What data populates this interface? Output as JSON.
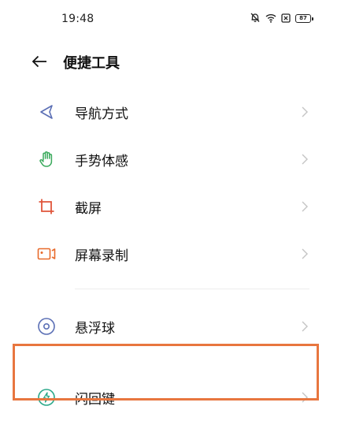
{
  "status_bar": {
    "time": "19:48",
    "battery": "87"
  },
  "header": {
    "title": "便捷工具"
  },
  "menu": {
    "items": [
      {
        "label": "导航方式",
        "icon": "navigation-triangle-icon"
      },
      {
        "label": "手势体感",
        "icon": "hand-gesture-icon"
      },
      {
        "label": "截屏",
        "icon": "crop-screenshot-icon"
      },
      {
        "label": "屏幕录制",
        "icon": "screen-record-icon"
      }
    ],
    "items2": [
      {
        "label": "悬浮球",
        "icon": "floating-ball-icon"
      },
      {
        "label": "闪回键",
        "icon": "flashback-key-icon"
      }
    ]
  },
  "colors": {
    "nav_icon": "#5b6fb5",
    "gesture_icon": "#3aaa5c",
    "screenshot_icon": "#e0553b",
    "record_icon": "#e86a2b",
    "ball_icon": "#5b6fb5",
    "flash_icon": "#2aa88a",
    "highlight": "#e8763f",
    "chevron": "#c4c4c4"
  }
}
